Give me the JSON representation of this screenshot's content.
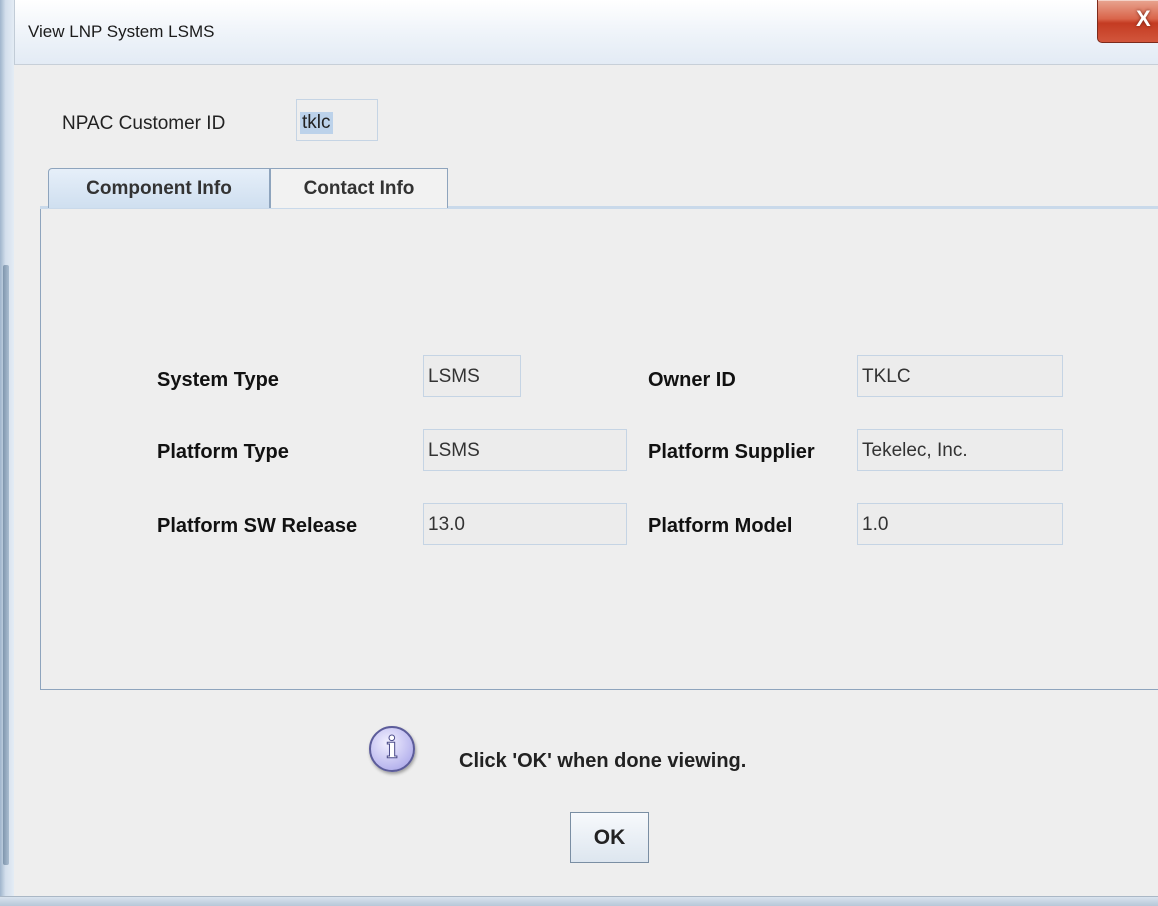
{
  "window": {
    "title": "View LNP System LSMS",
    "close_glyph": "X"
  },
  "npac": {
    "label": "NPAC Customer ID",
    "value": "tklc"
  },
  "tabs": [
    {
      "label": "Component Info",
      "active": true
    },
    {
      "label": "Contact Info",
      "active": false
    }
  ],
  "component_info": {
    "system_type": {
      "label": "System Type",
      "value": "LSMS"
    },
    "owner_id": {
      "label": "Owner ID",
      "value": "TKLC"
    },
    "platform_type": {
      "label": "Platform Type",
      "value": "LSMS"
    },
    "platform_supplier": {
      "label": "Platform Supplier",
      "value": "Tekelec, Inc."
    },
    "platform_sw_release": {
      "label": "Platform SW Release",
      "value": "13.0"
    },
    "platform_model": {
      "label": "Platform Model",
      "value": "1.0"
    }
  },
  "info": {
    "icon": "info-icon",
    "glyph": "i",
    "message": "Click 'OK' when done viewing."
  },
  "ok_button": {
    "label": "OK"
  },
  "colors": {
    "accent_tab": "#cfdff0",
    "close_button": "#c43b22",
    "info_icon": "#b9b6ee"
  }
}
